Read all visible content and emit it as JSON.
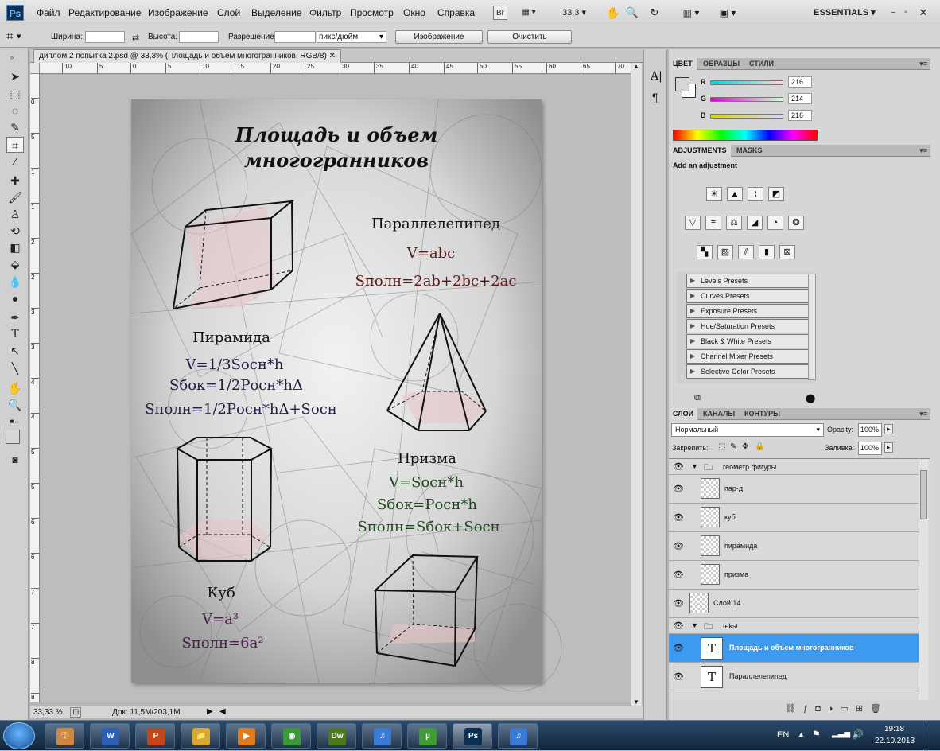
{
  "menubar": {
    "items": [
      "Файл",
      "Редактирование",
      "Изображение",
      "Слой",
      "Выделение",
      "Фильтр",
      "Просмотр",
      "Окно",
      "Справка"
    ],
    "bridge": "Br",
    "zoom": "33,3",
    "workspace": "ESSENTIALS"
  },
  "options": {
    "width_label": "Ширина:",
    "height_label": "Высота:",
    "resolution_label": "Разрешение:",
    "unit": "пикс/дюйм",
    "image_button": "Изображение",
    "clear_button": "Очистить"
  },
  "document": {
    "tab_title": "диплом 2 попытка 2.psd @ 33,3% (Площадь и объем многогранников, RGB/8)",
    "ruler_labels": [
      "10",
      "5",
      "0",
      "5",
      "10",
      "15",
      "20",
      "25",
      "30",
      "35",
      "40",
      "45",
      "50",
      "55",
      "60",
      "65",
      "70"
    ],
    "vruler_labels": [
      "0",
      "5",
      "1",
      "1",
      "2",
      "2",
      "3",
      "3",
      "4",
      "4",
      "5",
      "5",
      "6",
      "6",
      "7",
      "7",
      "8",
      "8"
    ],
    "status_zoom": "33,33 %",
    "status_doc": "Док: 11,5M/203,1M"
  },
  "poster": {
    "title_line1": "Площадь и объем",
    "title_line2": "многогранников",
    "parallelepiped": {
      "name": "Параллелепипед",
      "f1": "V=abc",
      "f2": "Sполн=2ab+2bc+2ac"
    },
    "pyramid": {
      "name": "Пирамида",
      "f1": "V=1/3Sосн*h",
      "f2": "Sбок=1/2Pосн*hΔ",
      "f3": "Sполн=1/2Pосн*hΔ+Sосн"
    },
    "prism": {
      "name": "Призма",
      "f1": "V=Sосн*h",
      "f2": "Sбок=Pосн*h",
      "f3": "Sполн=Sбок+Sосн"
    },
    "cube": {
      "name": "Куб",
      "f1": "V=a³",
      "f2": "Sполн=6a²"
    },
    "colors": {
      "parallelepiped": "#5a1a1a",
      "pyramid": "#1e1e4a",
      "prism": "#1d4a1d",
      "cube": "#4a1e4a"
    }
  },
  "color_panel": {
    "tabs": [
      "ЦВЕТ",
      "ОБРАЗЦЫ",
      "СТИЛИ"
    ],
    "r": {
      "label": "R",
      "value": "216"
    },
    "g": {
      "label": "G",
      "value": "214"
    },
    "b": {
      "label": "B",
      "value": "216"
    }
  },
  "adjustments": {
    "tabs": [
      "ADJUSTMENTS",
      "MASKS"
    ],
    "heading": "Add an adjustment",
    "presets": [
      "Levels Presets",
      "Curves Presets",
      "Exposure Presets",
      "Hue/Saturation Presets",
      "Black & White Presets",
      "Channel Mixer Presets",
      "Selective Color Presets"
    ]
  },
  "layers_panel": {
    "tabs": [
      "СЛОИ",
      "КАНАЛЫ",
      "КОНТУРЫ"
    ],
    "blend_mode": "Нормальный",
    "opacity_label": "Opacity:",
    "opacity": "100%",
    "lock_label": "Закрепить:",
    "fill_label": "Заливка:",
    "fill": "100%",
    "layers": [
      {
        "name": "геометр фигуры",
        "type": "group"
      },
      {
        "name": "пар-д",
        "type": "pixel"
      },
      {
        "name": "куб",
        "type": "pixel"
      },
      {
        "name": "пирамида",
        "type": "pixel"
      },
      {
        "name": "призма",
        "type": "pixel"
      },
      {
        "name": "Слой 14",
        "type": "pixel"
      },
      {
        "name": "tekst",
        "type": "group"
      },
      {
        "name": "Площадь и объем многогранников",
        "type": "text",
        "selected": true
      },
      {
        "name": "Параллелепипед",
        "type": "text"
      }
    ]
  },
  "taskbar": {
    "apps": [
      {
        "name": "paint",
        "label": "🎨",
        "color": "#c84"
      },
      {
        "name": "word",
        "label": "W",
        "color": "#2b5fb8"
      },
      {
        "name": "powerpoint",
        "label": "P",
        "color": "#c4451c"
      },
      {
        "name": "explorer",
        "label": "📁",
        "color": "#d9a832"
      },
      {
        "name": "media-player",
        "label": "▶",
        "color": "#e07b1f"
      },
      {
        "name": "chrome",
        "label": "◉",
        "color": "#3a9a3a"
      },
      {
        "name": "dreamweaver",
        "label": "Dw",
        "color": "#4a7a1c"
      },
      {
        "name": "itunes",
        "label": "♫",
        "color": "#3a7bd5"
      },
      {
        "name": "utorrent",
        "label": "µ",
        "color": "#3f9c35"
      },
      {
        "name": "photoshop",
        "label": "Ps",
        "color": "#0b2f55"
      },
      {
        "name": "itunes-2",
        "label": "♫",
        "color": "#3a7bd5"
      }
    ],
    "lang": "EN",
    "time": "19:18",
    "date": "22.10.2013"
  }
}
